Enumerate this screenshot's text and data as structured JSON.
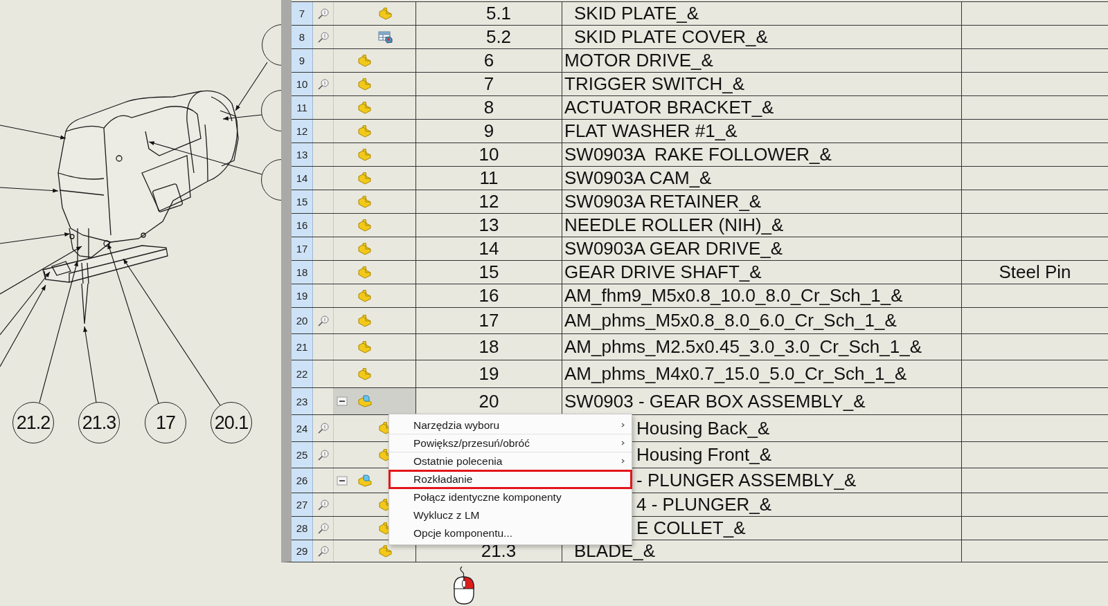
{
  "drawing": {
    "balloons": [
      {
        "kind": "edge"
      },
      {
        "kind": "edge"
      },
      {
        "kind": "edge"
      },
      {
        "label": "21.2",
        "kind": "bottom"
      },
      {
        "label": "21.3",
        "kind": "bottom"
      },
      {
        "label": "17",
        "kind": "bottom"
      },
      {
        "label": "20.1",
        "kind": "bottom"
      }
    ]
  },
  "bom_table": {
    "continued_rows": [
      {
        "row_number": "7",
        "preview": true,
        "kind": "part",
        "selected": false,
        "column_3": "5.1",
        "column_4": "SKID PLATE_&"
      },
      {
        "row_number": "8",
        "preview": true,
        "kind": "drawing",
        "selected": false,
        "column_3": "5.2",
        "column_4": "SKID PLATE COVER_&"
      }
    ],
    "rows": [
      {
        "row_number": "9",
        "preview": false,
        "kind": "part",
        "selected": false,
        "column_3": "6",
        "column_4": "MOTOR DRIVE_&"
      },
      {
        "row_number": "10",
        "preview": true,
        "kind": "part",
        "selected": false,
        "column_3": "7",
        "column_4": "TRIGGER SWITCH_&"
      },
      {
        "row_number": "11",
        "preview": false,
        "kind": "part",
        "selected": false,
        "column_3": "8",
        "column_4": "ACTUATOR BRACKET_&"
      },
      {
        "row_number": "12",
        "preview": false,
        "kind": "part",
        "selected": false,
        "column_3": "9",
        "column_4": "FLAT WASHER #1_&"
      },
      {
        "row_number": "13",
        "preview": false,
        "kind": "part",
        "selected": false,
        "column_3": "10",
        "column_4": "SW0903A  RAKE FOLLOWER_&"
      },
      {
        "row_number": "14",
        "preview": false,
        "kind": "part",
        "selected": false,
        "column_3": "11",
        "column_4": "SW0903A CAM_&"
      },
      {
        "row_number": "15",
        "preview": false,
        "kind": "part",
        "selected": false,
        "column_3": "12",
        "column_4": "SW0903A RETAINER_&"
      },
      {
        "row_number": "16",
        "preview": false,
        "kind": "part",
        "selected": false,
        "column_3": "13",
        "column_4": "NEEDLE ROLLER (NIH)_&"
      },
      {
        "row_number": "17",
        "preview": false,
        "kind": "part",
        "selected": false,
        "column_3": "14",
        "column_4": "SW0903A GEAR DRIVE_&"
      },
      {
        "row_number": "18",
        "preview": false,
        "kind": "part",
        "selected": false,
        "column_3": "15",
        "column_4": "GEAR DRIVE SHAFT_&",
        "column_5": "Steel Pin"
      },
      {
        "row_number": "19",
        "preview": false,
        "kind": "part",
        "selected": false,
        "column_3": "16",
        "column_4": "AM_fhm9_M5x0.8_10.0_8.0_Cr_Sch_1_&"
      },
      {
        "row_number": "20",
        "preview": true,
        "kind": "part",
        "selected": false,
        "column_3": "17",
        "column_4": "AM_phms_M5x0.8_8.0_6.0_Cr_Sch_1_&"
      },
      {
        "row_number": "21",
        "preview": false,
        "kind": "part",
        "selected": false,
        "column_3": "18",
        "column_4": "AM_phms_M2.5x0.45_3.0_3.0_Cr_Sch_1_&"
      },
      {
        "row_number": "22",
        "preview": false,
        "kind": "part",
        "selected": false,
        "column_3": "19",
        "column_4": "AM_phms_M4x0.7_15.0_5.0_Cr_Sch_1_&"
      },
      {
        "row_number": "23",
        "preview": false,
        "kind": "assembly",
        "selected": true,
        "expanded": true,
        "column_3": "20",
        "column_4": "SW0903 - GEAR BOX ASSEMBLY_&",
        "children": [
          {
            "row_number": "24",
            "preview": true,
            "kind": "part",
            "selected": false,
            "column_4": "Housing Back_&"
          },
          {
            "row_number": "25",
            "preview": true,
            "kind": "part",
            "selected": false,
            "column_4": "Housing Front_&"
          }
        ]
      },
      {
        "row_number": "26",
        "preview": false,
        "kind": "assembly",
        "selected": false,
        "expanded": true,
        "column_4": "- PLUNGER ASSEMBLY_&",
        "children": [
          {
            "row_number": "27",
            "preview": true,
            "kind": "part",
            "selected": false,
            "column_4": "4 - PLUNGER_&"
          },
          {
            "row_number": "28",
            "preview": true,
            "kind": "part",
            "selected": false,
            "column_4": "E COLLET_&"
          },
          {
            "row_number": "29",
            "preview": true,
            "kind": "part",
            "selected": false,
            "column_3": "21.3",
            "column_4": "BLADE_&"
          }
        ]
      }
    ]
  },
  "context_menu": {
    "items": [
      {
        "label": "Narzędzia wyboru",
        "submenu": true,
        "highlighted": false
      },
      {
        "label": "Powiększ/przesuń/obróć",
        "submenu": true,
        "highlighted": false
      },
      {
        "label": "Ostatnie polecenia",
        "submenu": true,
        "highlighted": false
      },
      {
        "label": "Rozkładanie",
        "submenu": false,
        "highlighted": true
      },
      {
        "label": "Połącz identyczne komponenty",
        "submenu": false,
        "highlighted": false
      },
      {
        "label": "Wyklucz z LM",
        "submenu": false,
        "highlighted": false
      },
      {
        "label": "Opcje komponentu...",
        "submenu": false,
        "highlighted": false
      }
    ]
  },
  "mouse_hint": {
    "right_button_pressed": true
  }
}
